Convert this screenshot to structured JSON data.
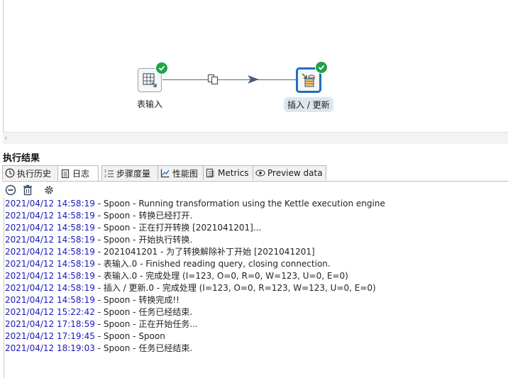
{
  "canvas": {
    "steps": [
      {
        "label": "表输入"
      },
      {
        "label": "插入 / 更新"
      }
    ]
  },
  "results": {
    "title": "执行结果",
    "tabs": [
      {
        "label": "执行历史",
        "icon": "history-icon"
      },
      {
        "label": "日志",
        "icon": "log-icon"
      },
      {
        "label": "步骤度量",
        "icon": "step-metrics-icon"
      },
      {
        "label": "性能图",
        "icon": "performance-chart-icon"
      },
      {
        "label": "Metrics",
        "icon": "metrics-icon"
      },
      {
        "label": "Preview data",
        "icon": "preview-eye-icon"
      }
    ],
    "active_tab": "日志",
    "toolbar": {
      "icons": [
        "clear-log-icon",
        "delete-icon",
        "settings-gear-icon"
      ]
    },
    "log_lines": [
      {
        "ts": "2021/04/12 14:58:19",
        "msg": " - Spoon - Running transformation using the Kettle execution engine"
      },
      {
        "ts": "2021/04/12 14:58:19",
        "msg": " - Spoon - 转换已经打开."
      },
      {
        "ts": "2021/04/12 14:58:19",
        "msg": " - Spoon - 正在打开转换 [2021041201]..."
      },
      {
        "ts": "2021/04/12 14:58:19",
        "msg": " - Spoon - 开始执行转换."
      },
      {
        "ts": "2021/04/12 14:58:19",
        "msg": " - 2021041201 - 为了转换解除补丁开始  [2021041201]"
      },
      {
        "ts": "2021/04/12 14:58:19",
        "msg": " - 表输入.0 - Finished reading query, closing connection."
      },
      {
        "ts": "2021/04/12 14:58:19",
        "msg": " - 表输入.0 - 完成处理 (I=123, O=0, R=0, W=123, U=0, E=0)"
      },
      {
        "ts": "2021/04/12 14:58:19",
        "msg": " - 插入 / 更新.0 - 完成处理 (I=123, O=0, R=123, W=123, U=0, E=0)"
      },
      {
        "ts": "2021/04/12 14:58:19",
        "msg": " - Spoon - 转换完成!!"
      },
      {
        "ts": "2021/04/12 15:22:42",
        "msg": " - Spoon - 任务已经结束."
      },
      {
        "ts": "2021/04/12 17:18:59",
        "msg": " - Spoon - 正在开始任务..."
      },
      {
        "ts": "2021/04/12 17:19:45",
        "msg": " - Spoon - Spoon"
      },
      {
        "ts": "2021/04/12 18:19:03",
        "msg": " - Spoon - 任务已经结束."
      }
    ]
  },
  "colors": {
    "timestamp": "#1a1ab8",
    "success_badge": "#22a34a",
    "selected_border": "#1f6fbf"
  }
}
